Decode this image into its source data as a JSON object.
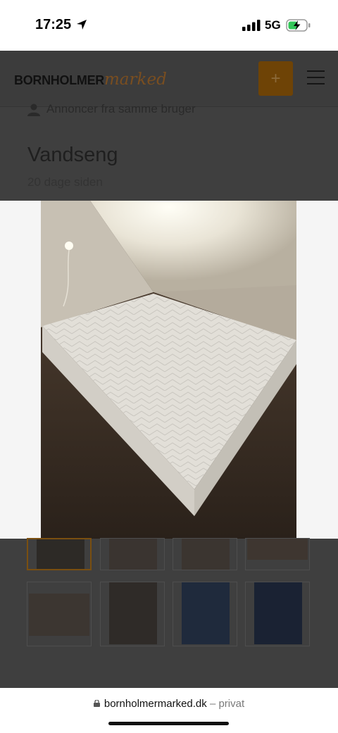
{
  "status_bar": {
    "time": "17:25",
    "network": "5G"
  },
  "header": {
    "logo_bold": "BORNHOLMER",
    "logo_script": "marked",
    "add_label": "+",
    "accent_color": "#6e4306"
  },
  "listing": {
    "same_user_label": "Annoncer fra samme bruger",
    "title": "Vandseng",
    "posted_ago": "20 dage siden"
  },
  "browser": {
    "domain": "bornholmermarked.dk",
    "mode": "– privat"
  },
  "icons": {
    "location": "location-arrow-icon",
    "signal": "signal-bars-icon",
    "battery": "battery-charging-icon",
    "menu": "hamburger-menu-icon",
    "user": "user-icon",
    "lock": "lock-icon"
  }
}
